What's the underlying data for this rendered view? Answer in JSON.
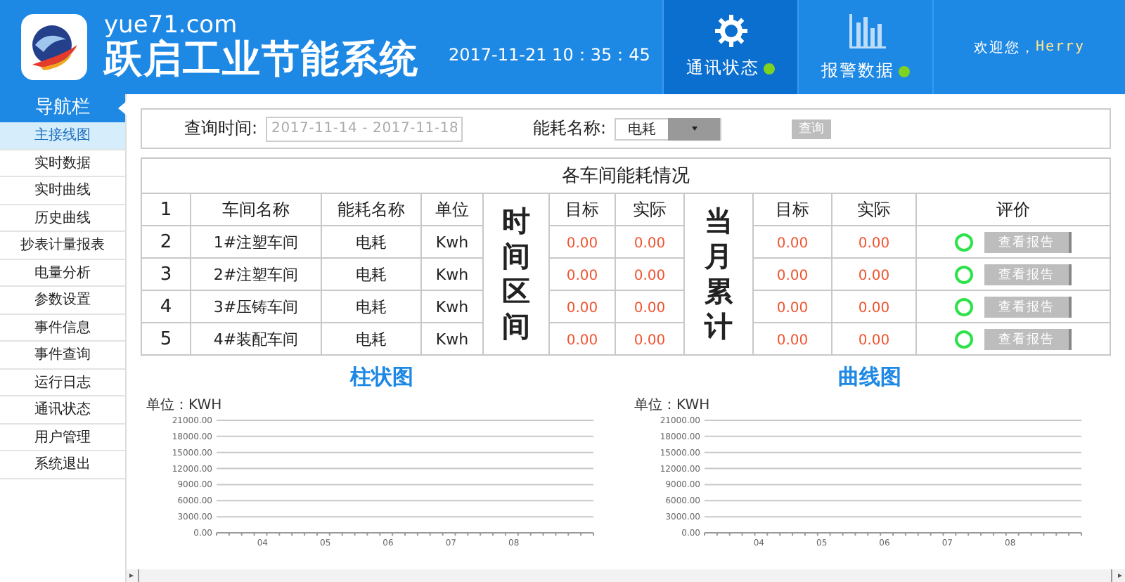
{
  "header": {
    "site": "yue71.com",
    "title": "跃启工业节能系统",
    "datetime": "2017-11-21 10：35：45",
    "tabs": [
      {
        "kind": "gear",
        "label": "通讯状态",
        "selected": true,
        "on": true
      },
      {
        "kind": "bars",
        "label": "报警数据",
        "selected": false,
        "on": true
      }
    ],
    "welcome": "欢迎您，",
    "user": "Herry"
  },
  "sidebar": {
    "title": "导航栏",
    "items": [
      {
        "label": "主接线图",
        "selected": true
      },
      {
        "label": "实时数据",
        "selected": false
      },
      {
        "label": "实时曲线",
        "selected": false
      },
      {
        "label": "历史曲线",
        "selected": false
      },
      {
        "label": "抄表计量报表",
        "selected": false
      },
      {
        "label": "电量分析",
        "selected": false
      },
      {
        "label": "参数设置",
        "selected": false
      },
      {
        "label": "事件信息",
        "selected": false
      },
      {
        "label": "事件查询",
        "selected": false
      },
      {
        "label": "运行日志",
        "selected": false
      },
      {
        "label": "通讯状态",
        "selected": false
      },
      {
        "label": "用户管理",
        "selected": false
      },
      {
        "label": "系统退出",
        "selected": false
      }
    ]
  },
  "query": {
    "time_label": "查询时间:",
    "time_placeholder": "2017-11-14 - 2017-11-18",
    "energy_label": "能耗名称:",
    "energy_value": "电耗",
    "button": "查询"
  },
  "table": {
    "title": "各车间能耗情况",
    "header": {
      "no": "1",
      "name": "车间名称",
      "energy": "能耗名称",
      "unit": "单位",
      "target": "目标",
      "actual": "实际",
      "month_target": "目标",
      "month_actual": "实际",
      "evaluation": "评价"
    },
    "period": "时间区间",
    "month": "当月累计",
    "rows": [
      {
        "no": "2",
        "name": "1#注塑车间",
        "energy": "电耗",
        "unit": "Kwh",
        "target": "0.00",
        "actual": "0.00",
        "month_target": "0.00",
        "month_actual": "0.00",
        "ok": true,
        "button": "查看报告"
      },
      {
        "no": "3",
        "name": "2#注塑车间",
        "energy": "电耗",
        "unit": "Kwh",
        "target": "0.00",
        "actual": "0.00",
        "month_target": "0.00",
        "month_actual": "0.00",
        "ok": true,
        "button": "查看报告"
      },
      {
        "no": "4",
        "name": "3#压铸车间",
        "energy": "电耗",
        "unit": "Kwh",
        "target": "0.00",
        "actual": "0.00",
        "month_target": "0.00",
        "month_actual": "0.00",
        "ok": true,
        "button": "查看报告"
      },
      {
        "no": "5",
        "name": "4#装配车间",
        "energy": "电耗",
        "unit": "Kwh",
        "target": "0.00",
        "actual": "0.00",
        "month_target": "0.00",
        "month_actual": "0.00",
        "ok": true,
        "button": "查看报告"
      }
    ]
  },
  "charts": [
    {
      "heading": "柱状图",
      "chart_data": {
        "type": "bar",
        "ylabel": "单位：KWH",
        "categories": [
          "04",
          "05",
          "06",
          "07",
          "08"
        ],
        "grid": true,
        "ylim": [
          0,
          21000
        ],
        "yticks": [
          {
            "value": 0,
            "label": "0.00"
          },
          {
            "value": 3000,
            "label": "3000.00"
          },
          {
            "value": 6000,
            "label": "6000.00"
          },
          {
            "value": 9000,
            "label": "9000.00"
          },
          {
            "value": 12000,
            "label": "12000.00"
          },
          {
            "value": 15000,
            "label": "15000.00"
          },
          {
            "value": 18000,
            "label": "18000.00"
          },
          {
            "value": 21000,
            "label": "21000.00"
          }
        ]
      }
    },
    {
      "heading": "曲线图",
      "chart_data": {
        "type": "line",
        "ylabel": "单位：KWH",
        "categories": [
          "04",
          "05",
          "06",
          "07",
          "08"
        ],
        "grid": true,
        "ylim": [
          0,
          21000
        ],
        "yticks": [
          {
            "value": 0,
            "label": "0.00"
          },
          {
            "value": 3000,
            "label": "3000.00"
          },
          {
            "value": 6000,
            "label": "6000.00"
          },
          {
            "value": 9000,
            "label": "9000.00"
          },
          {
            "value": 12000,
            "label": "12000.00"
          },
          {
            "value": 15000,
            "label": "15000.00"
          },
          {
            "value": 18000,
            "label": "18000.00"
          },
          {
            "value": 21000,
            "label": "21000.00"
          }
        ]
      }
    }
  ]
}
